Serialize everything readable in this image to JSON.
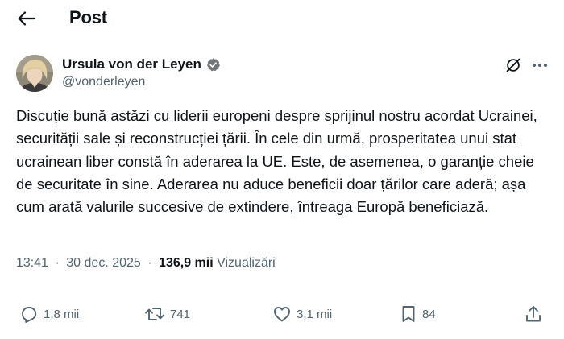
{
  "header": {
    "title": "Post",
    "back_icon": "arrow-left-icon"
  },
  "author": {
    "name": "Ursula von der Leyen",
    "handle": "@vonderleyen",
    "verified": true,
    "verified_color": "#71767b"
  },
  "post": {
    "text": "Discuție bună astăzi cu liderii europeni despre sprijinul nostru acordat Ucrainei, securității sale și reconstrucției țării. În cele din urmă, prosperitatea unui stat ucrainean liber constă în aderarea la UE. Este, de asemenea, o garanție cheie de securitate în sine. Aderarea nu aduce beneficii doar țărilor care aderă; așa cum arată valurile succesive de extindere, întreaga Europă beneficiază."
  },
  "meta": {
    "time": "13:41",
    "date": "30 dec. 2025",
    "separator": "·",
    "views_count": "136,9 mii",
    "views_label": "Vizualizări"
  },
  "actions": {
    "replies": "1,8 mii",
    "reposts": "741",
    "likes": "3,1 mii",
    "bookmarks": "84"
  },
  "colors": {
    "text": "#0f1419",
    "secondary": "#536471",
    "background": "#ffffff"
  }
}
